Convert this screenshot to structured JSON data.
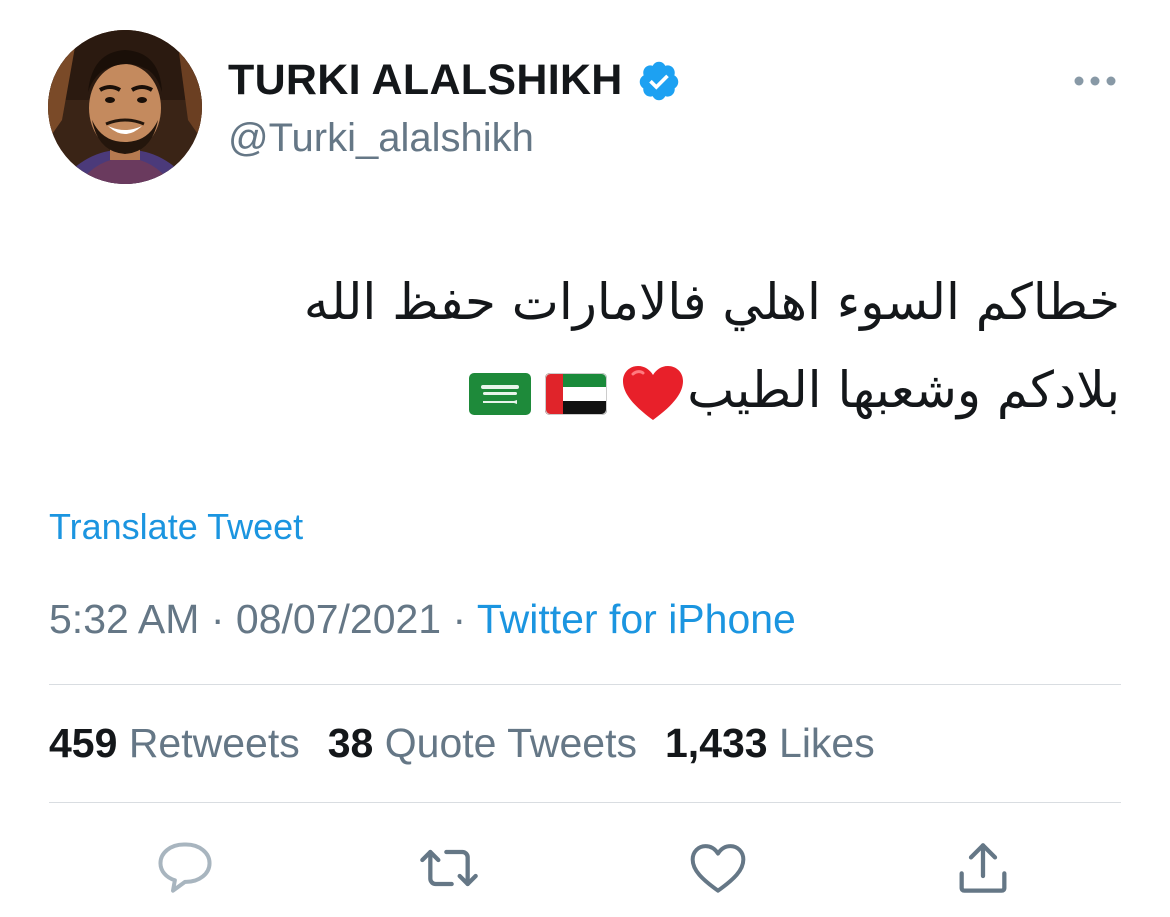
{
  "author": {
    "display_name": "TURKI ALALSHIKH",
    "handle": "@Turki_alalshikh",
    "verified": true,
    "avatar_icon": "profile-photo"
  },
  "tweet": {
    "lines": [
      "خطاكم السوء اهلي فالامارات حفظ الله",
      "بلادكم وشعبها الطيب"
    ],
    "emojis": [
      "red-heart",
      "flag-united-arab-emirates",
      "flag-saudi-arabia"
    ],
    "translate_label": "Translate Tweet"
  },
  "meta": {
    "time": "5:32 AM",
    "separator": "·",
    "date": "08/07/2021",
    "source": "Twitter for iPhone"
  },
  "stats": {
    "retweets": {
      "count": "459",
      "label": "Retweets"
    },
    "quote_tweets": {
      "count": "38",
      "label": "Quote Tweets"
    },
    "likes": {
      "count": "1,433",
      "label": "Likes"
    }
  },
  "actions": {
    "icons": [
      "reply-icon",
      "retweet-icon",
      "like-icon",
      "share-icon"
    ]
  },
  "colors": {
    "link": "#1b95e0",
    "muted": "#657786",
    "text": "#14171a",
    "divider": "#d9dde1",
    "verified": "#1da1f2"
  }
}
